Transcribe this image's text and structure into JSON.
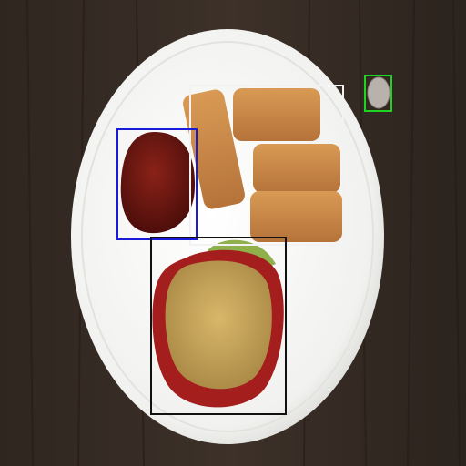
{
  "scene": {
    "description_objects": [
      {
        "name": "fish-sticks",
        "box_color": "#ffffff"
      },
      {
        "name": "ketchup",
        "box_color": "#1a1adc"
      },
      {
        "name": "applesauce-bowl",
        "box_color": "#111111"
      },
      {
        "name": "small-object",
        "box_color": "#1fd41f"
      }
    ]
  },
  "colors": {
    "table": "#3a3028",
    "plate": "#f4f4f2",
    "ketchup": "#6e1612",
    "fish_stick": "#c98a4a",
    "applesauce": "#c8a65a",
    "bowl_red": "#a51e1e",
    "leaf": "#8fb04a"
  }
}
